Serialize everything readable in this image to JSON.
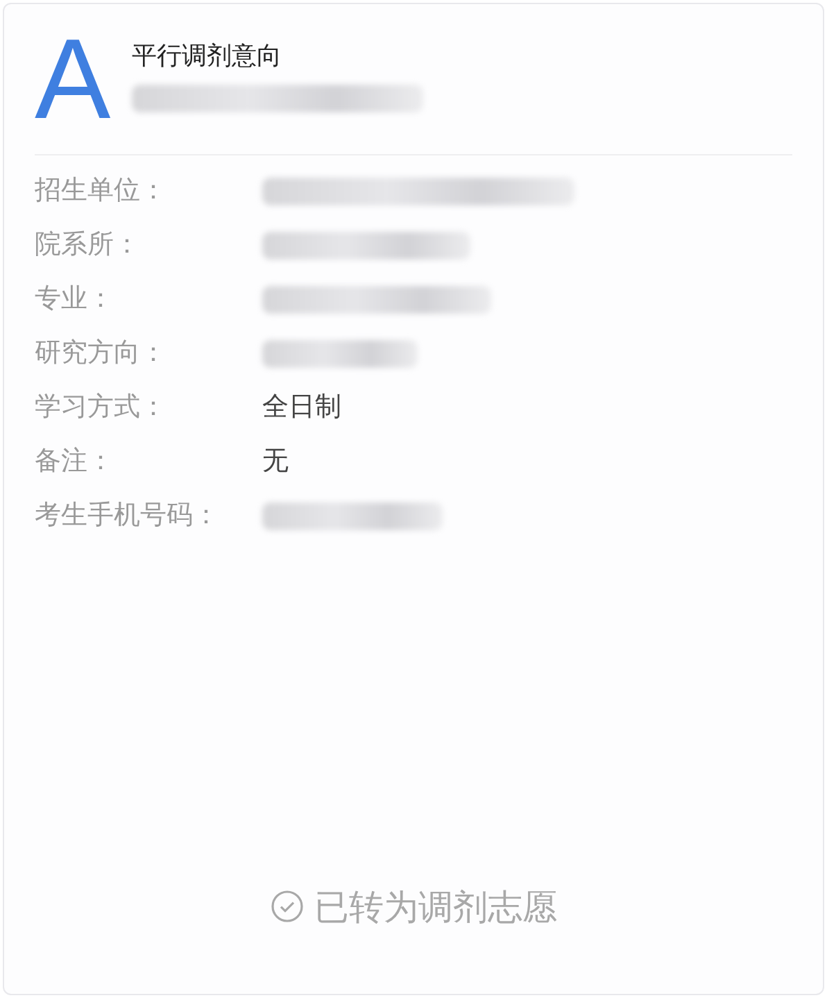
{
  "header": {
    "letter": "A",
    "title": "平行调剂意向",
    "subtitle": {
      "kind": "redacted"
    }
  },
  "fields": [
    {
      "label": "招生单位：",
      "value": {
        "kind": "redacted"
      }
    },
    {
      "label": "院系所：",
      "value": {
        "kind": "redacted"
      }
    },
    {
      "label": "专业：",
      "value": {
        "kind": "redacted"
      }
    },
    {
      "label": "研究方向：",
      "value": {
        "kind": "redacted"
      }
    },
    {
      "label": "学习方式：",
      "value": {
        "kind": "text",
        "text": "全日制"
      }
    },
    {
      "label": "备注：",
      "value": {
        "kind": "text",
        "text": "无"
      }
    },
    {
      "label": "考生手机号码：",
      "value": {
        "kind": "redacted"
      }
    }
  ],
  "status": {
    "text": "已转为调剂志愿"
  }
}
